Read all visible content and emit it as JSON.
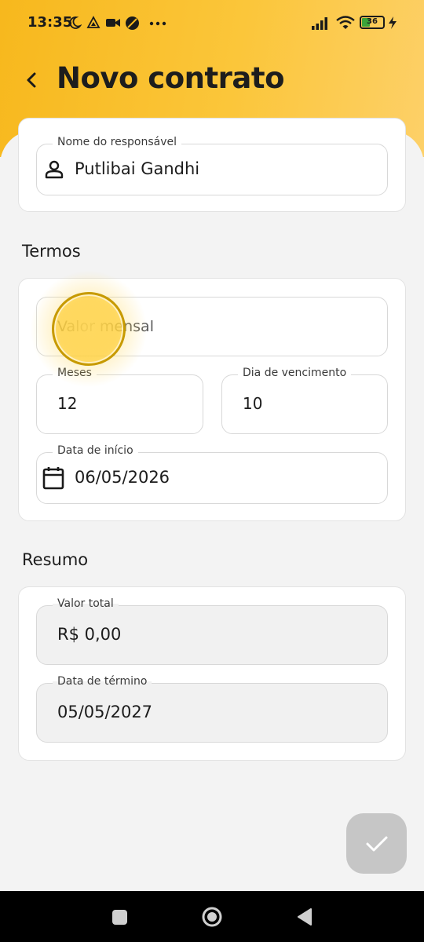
{
  "status_bar": {
    "time": "13:35",
    "battery": "36"
  },
  "header": {
    "title": "Novo contrato"
  },
  "responsible": {
    "label": "Nome do responsável",
    "value": "Putlibai Gandhi"
  },
  "terms": {
    "section_title": "Termos",
    "monthly_value_placeholder": "Valor mensal",
    "months_label": "Meses",
    "months_value": "12",
    "due_day_label": "Dia de vencimento",
    "due_day_value": "10",
    "start_date_label": "Data de início",
    "start_date_value": "06/05/2026"
  },
  "summary": {
    "section_title": "Resumo",
    "total_label": "Valor total",
    "total_value": "R$ 0,00",
    "end_date_label": "Data de término",
    "end_date_value": "05/05/2027"
  },
  "colors": {
    "header_start": "#f7b81d",
    "header_end": "#fdd068",
    "fab": "#c6c6c6"
  }
}
